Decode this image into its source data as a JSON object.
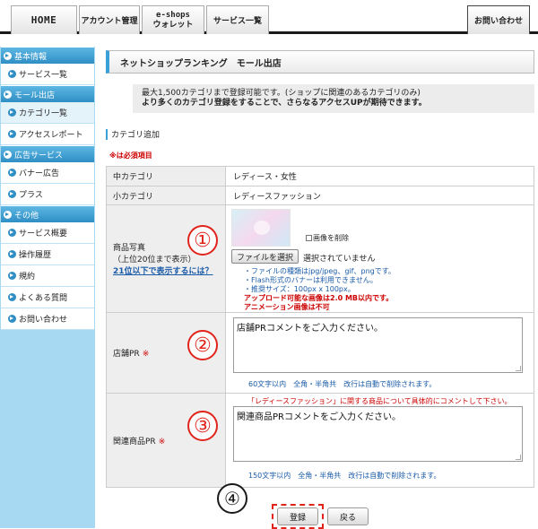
{
  "nav": {
    "home": "HOME",
    "account": "アカウント管理",
    "eshops_line1": "e-shops",
    "eshops_line2": "ウォレット",
    "services": "サービス一覧",
    "contact": "お問い合わせ"
  },
  "sidebar": {
    "basic": "基本情報",
    "service_list": "サービス一覧",
    "mall": "モール出店",
    "category_list": "カテゴリ一覧",
    "access_report": "アクセスレポート",
    "ads": "広告サービス",
    "banner_ad": "バナー広告",
    "plus": "プラス",
    "other": "その他",
    "service_overview": "サービス概要",
    "op_history": "操作履歴",
    "terms": "規約",
    "faq": "よくある質問",
    "inquiry": "お問い合わせ"
  },
  "page": {
    "title": "ネットショップランキング　モール出店",
    "notice_line1": "最大1,500カテゴリまで登録可能です。(ショップに関連のあるカテゴリのみ)",
    "notice_line2": "より多くのカテゴリ登録をすることで、さらなるアクセスUPが期待できます。",
    "section_title": "カテゴリ追加",
    "required_note": "※は必須項目"
  },
  "form": {
    "main_cat_label": "中カテゴリ",
    "main_cat_value": "レディース・女性",
    "sub_cat_label": "小カテゴリ",
    "sub_cat_value": "レディースファッション",
    "photo_label": "商品写真",
    "photo_sublabel": "（上位20位まで表示）",
    "photo_link": "21位以下で表示するには？",
    "delete_image": "画像を削除",
    "file_button": "ファイルを選択",
    "file_status": "選択されていません",
    "hint1": "・ファイルの種類はjpg/jpeg、gif、pngです。",
    "hint2": "・Flash形式のバナーは利用できません。",
    "hint3": "・推奨サイズ：100px x 100px。",
    "warn1": "アップロード可能な画像は2.0 MB以内です。",
    "warn2": "アニメーション画像は不可",
    "shop_pr_label": "店舗PR",
    "shop_pr_mark": "※",
    "shop_pr_placeholder": "店舗PRコメントをご入力ください。",
    "shop_pr_count": "60文字以内　全角・半角共　改行は自動で削除されます。",
    "related_note": "「レディースファッション」に関する商品について具体的にコメントして下さい。",
    "related_label": "関連商品PR",
    "related_mark": "※",
    "related_placeholder": "関連商品PRコメントをご入力ください。",
    "related_count": "150文字以内　全角・半角共　改行は自動で削除されます。"
  },
  "annotations": {
    "c1": "①",
    "c2": "②",
    "c3": "③",
    "c4": "④"
  },
  "buttons": {
    "register": "登録",
    "back": "戻る"
  },
  "colors": {
    "accent": "#3aa0d8",
    "annotation_red": "#e0241b",
    "sidebar_bg": "#a8d9f2"
  }
}
